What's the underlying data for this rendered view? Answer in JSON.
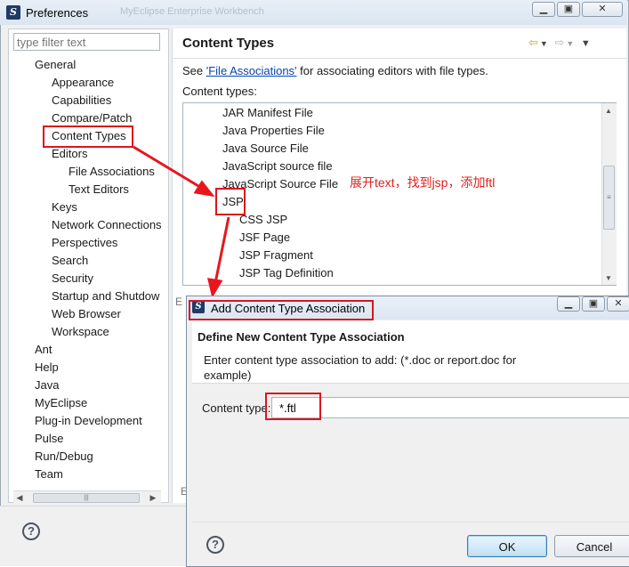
{
  "window": {
    "title": "Preferences",
    "ghost_title": "MyEclipse Enterprise Workbench"
  },
  "filter": {
    "placeholder": "type filter text"
  },
  "tree": {
    "items": [
      {
        "label": "General",
        "level": 0
      },
      {
        "label": "Appearance",
        "level": 1
      },
      {
        "label": "Capabilities",
        "level": 1
      },
      {
        "label": "Compare/Patch",
        "level": 1
      },
      {
        "label": "Content Types",
        "level": 1,
        "selected": true
      },
      {
        "label": "Editors",
        "level": 1
      },
      {
        "label": "File Associations",
        "level": 2
      },
      {
        "label": "Text Editors",
        "level": 2
      },
      {
        "label": "Keys",
        "level": 1
      },
      {
        "label": "Network Connections",
        "level": 1
      },
      {
        "label": "Perspectives",
        "level": 1
      },
      {
        "label": "Search",
        "level": 1
      },
      {
        "label": "Security",
        "level": 1
      },
      {
        "label": "Startup and Shutdow",
        "level": 1
      },
      {
        "label": "Web Browser",
        "level": 1
      },
      {
        "label": "Workspace",
        "level": 1
      },
      {
        "label": "Ant",
        "level": 0
      },
      {
        "label": "Help",
        "level": 0
      },
      {
        "label": "Java",
        "level": 0
      },
      {
        "label": "MyEclipse",
        "level": 0
      },
      {
        "label": "Plug-in Development",
        "level": 0
      },
      {
        "label": "Pulse",
        "level": 0
      },
      {
        "label": "Run/Debug",
        "level": 0
      },
      {
        "label": "Team",
        "level": 0
      }
    ]
  },
  "content": {
    "title": "Content Types",
    "see_prefix": "See ",
    "see_link": "'File Associations'",
    "see_suffix": " for associating editors with file types.",
    "types_label": "Content types:",
    "types": [
      {
        "label": "JAR Manifest File"
      },
      {
        "label": "Java Properties File"
      },
      {
        "label": "Java Source File"
      },
      {
        "label": "JavaScript source file"
      },
      {
        "label": "JavaScript Source File"
      },
      {
        "label": "JSP",
        "highlighted": true
      },
      {
        "label": "CSS JSP"
      },
      {
        "label": "JSF Page"
      },
      {
        "label": "JSP Fragment"
      },
      {
        "label": "JSP Tag Definition"
      }
    ]
  },
  "annotation": {
    "text": "展开text，找到jsp，添加ftl",
    "color": "#e02020"
  },
  "dialog": {
    "title": "Add Content Type Association",
    "heading": "Define New Content Type Association",
    "description": "Enter content type association to add: (*.doc or report.doc for example)",
    "field_label": "Content type:",
    "field_value": "*.ftl",
    "ok_label": "OK",
    "cancel_label": "Cancel"
  },
  "colors": {
    "highlight": "#d9161c",
    "link": "#0645ad"
  }
}
